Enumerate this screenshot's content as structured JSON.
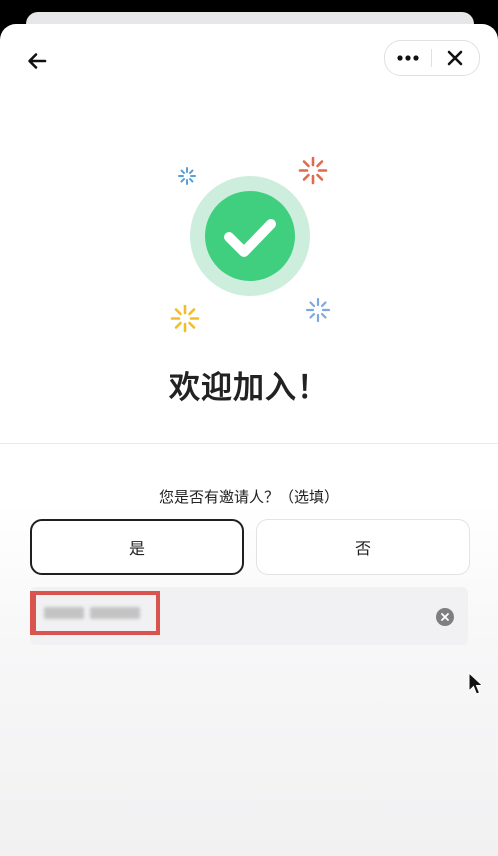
{
  "header": {
    "back_icon": "arrow-left-icon",
    "more_icon": "ellipsis-icon",
    "close_icon": "close-icon"
  },
  "hero": {
    "icon": "check-circle-icon",
    "accent_color": "#3fcf7e",
    "sparkle_colors": [
      "#5a9fd8",
      "#e06a4d",
      "#f2bd2a",
      "#7fa8e0"
    ],
    "title": "欢迎加入！"
  },
  "invite": {
    "question": "您是否有邀请人？（选填）",
    "yes_label": "是",
    "no_label": "否",
    "selected": "是",
    "clear_icon": "clear-circle-icon"
  }
}
